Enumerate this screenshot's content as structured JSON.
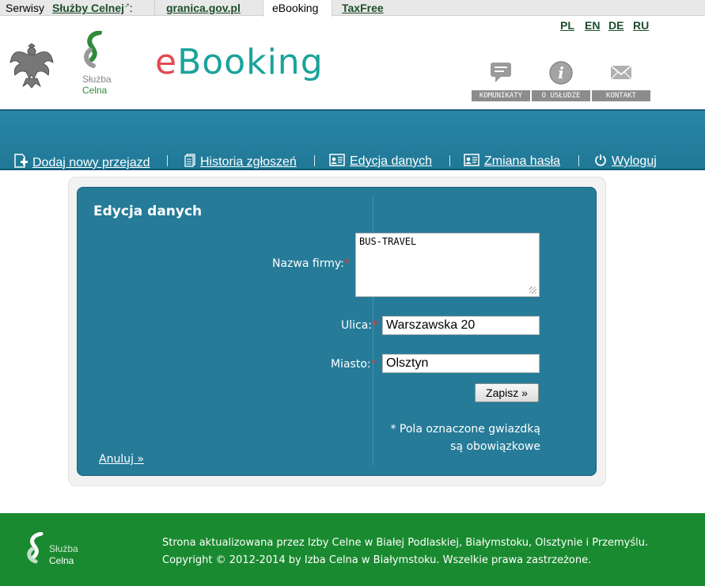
{
  "service_bar": {
    "prefix": "Serwisy",
    "sc_link": "Służby Celnej",
    "ext_mark": "↗",
    "colon": ":",
    "tabs": [
      {
        "label": "granica.gov.pl"
      },
      {
        "label": "eBooking"
      },
      {
        "label": "TaxFree"
      }
    ]
  },
  "languages": [
    "PL",
    "EN",
    "DE",
    "RU"
  ],
  "header": {
    "brand_e": "e",
    "brand_rest": "Booking",
    "sc_logo_line1": "Służba",
    "sc_logo_line2": "Celna",
    "icons": [
      {
        "label": "KOMUNIKATY",
        "icon": "speech-bubble-icon"
      },
      {
        "label": "O USŁUDZE",
        "icon": "info-icon"
      },
      {
        "label": "KONTAKT",
        "icon": "envelope-icon"
      }
    ]
  },
  "nav": {
    "items": [
      {
        "label": "Dodaj nowy przejazd",
        "icon": "add-document-icon"
      },
      {
        "label": "Historia zgłoszeń",
        "icon": "history-document-icon"
      },
      {
        "label": "Edycja danych",
        "icon": "id-card-icon"
      },
      {
        "label": "Zmiana hasła",
        "icon": "id-card-icon"
      },
      {
        "label": "Wyloguj",
        "icon": "power-icon"
      }
    ]
  },
  "form": {
    "title": "Edycja danych",
    "required_mark": "*",
    "company_label": "Nazwa firmy:",
    "company_value": "BUS-TRAVEL",
    "street_label": "Ulica:",
    "street_value": "Warszawska 20",
    "city_label": "Miasto:",
    "city_value": "Olsztyn",
    "save_label": "Zapisz »",
    "note_line1": "* Pola oznaczone gwiazdką",
    "note_line2": "są obowiązkowe",
    "cancel_label": "Anuluj »"
  },
  "footer": {
    "logo_line1": "Służba",
    "logo_line2": "Celna",
    "line1": "Strona aktualizowana przez Izby Celne w Białej Podlaskiej, Białymstoku, Olsztynie i Przemyślu.",
    "line2": "Copyright © 2012-2014 by Izba Celna w Białymstoku. Wszelkie prawa zastrzeżone."
  },
  "colors": {
    "nav_blue": "#2a86a6",
    "panel_blue": "#267b98",
    "footer_green": "#1a8a30",
    "brand_teal": "#1aa39a",
    "brand_red": "#e24a52",
    "link_green": "#1e4d2b",
    "required_red": "#e23b3b"
  }
}
